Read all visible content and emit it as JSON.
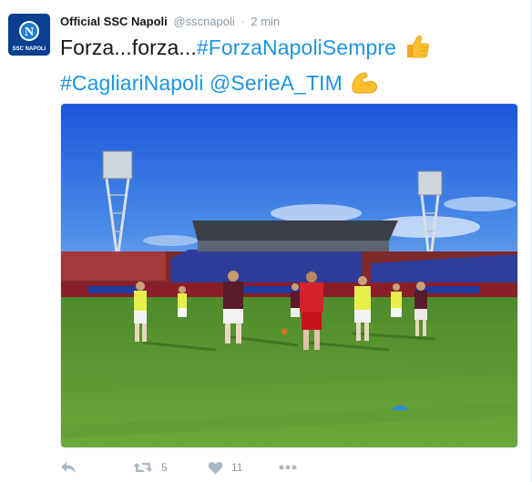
{
  "tweet": {
    "display_name": "Official SSC Napoli",
    "handle": "@sscnapoli",
    "separator": "·",
    "time": "2 min",
    "text_plain_1": "Forza...forza...",
    "hashtag_1": "#ForzaNapoliSempre",
    "hashtag_2": "#CagliariNapoli",
    "mention": "@SerieA_TIM",
    "emojis": [
      "thumbs-up",
      "flexed-biceps"
    ]
  },
  "avatar": {
    "logo_letter": "N",
    "logo_text": "SSC NAPOLI"
  },
  "photo": {
    "description_icon": "football-training-photo"
  },
  "actions": {
    "reply": {
      "icon": "reply-icon"
    },
    "retweet": {
      "icon": "retweet-icon",
      "count": "5"
    },
    "like": {
      "icon": "heart-icon",
      "count": "11"
    },
    "more": {
      "icon": "more-icon"
    }
  },
  "colors": {
    "link": "#1b95e0",
    "muted": "#8899a6",
    "action_icon": "#aab8c2",
    "brand": "#0a3d91"
  }
}
